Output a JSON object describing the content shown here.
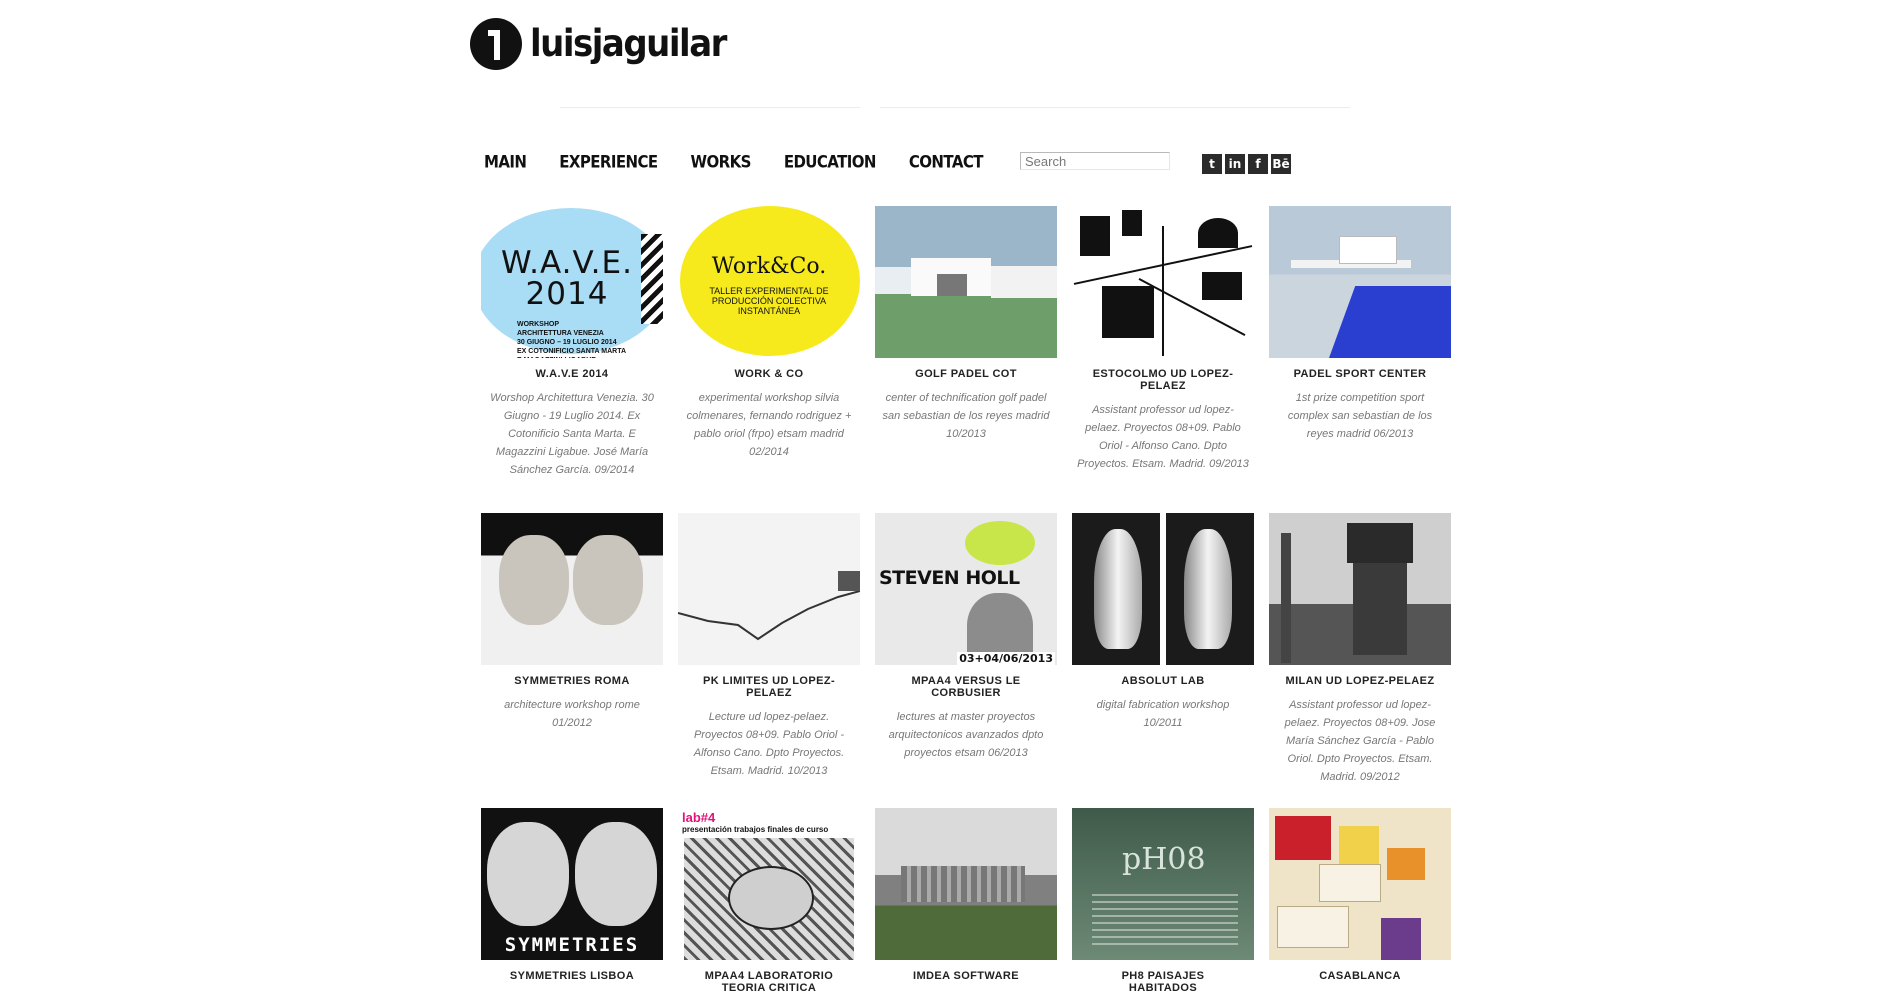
{
  "brand": {
    "name": "luisjaguilar"
  },
  "nav": {
    "items": [
      "MAIN",
      "EXPERIENCE",
      "WORKS",
      "EDUCATION",
      "CONTACT"
    ]
  },
  "search": {
    "placeholder": "Search"
  },
  "social": {
    "icons": [
      "twitter-icon",
      "linkedin-icon",
      "facebook-icon",
      "behance-icon"
    ],
    "labels": [
      "t",
      "in",
      "f",
      "Bē"
    ]
  },
  "works": [
    {
      "title": "W.A.V.E 2014",
      "desc": "Worshop Architettura Venezia. 30 Giugno - 19 Luglio 2014. Ex Cotonificio Santa Marta. E Magazzini Ligabue. José María Sánchez García. 09/2014"
    },
    {
      "title": "WORK & CO",
      "desc": "experimental workshop silvia colmenares, fernando rodriguez + pablo oriol (frpo) etsam madrid 02/2014"
    },
    {
      "title": "GOLF PADEL COT",
      "desc": "center of technification golf padel san sebastian de los reyes madrid 10/2013"
    },
    {
      "title": "ESTOCOLMO UD LOPEZ-PELAEZ",
      "desc": "Assistant professor ud lopez-pelaez. Proyectos 08+09. Pablo Oriol - Alfonso Cano. Dpto Proyectos. Etsam. Madrid. 09/2013"
    },
    {
      "title": "PADEL SPORT CENTER",
      "desc": "1st prize competition sport complex san sebastian de los reyes madrid 06/2013"
    },
    {
      "title": "SYMMETRIES ROMA",
      "desc": "architecture workshop rome 01/2012"
    },
    {
      "title": "PK LIMITES UD LOPEZ-PELAEZ",
      "desc": "Lecture ud lopez-pelaez. Proyectos 08+09. Pablo Oriol - Alfonso Cano. Dpto Proyectos. Etsam. Madrid. 10/2013"
    },
    {
      "title": "MPAA4 VERSUS LE CORBUSIER",
      "desc": "lectures at master proyectos arquitectonicos avanzados dpto proyectos etsam 06/2013"
    },
    {
      "title": "ABSOLUT LAB",
      "desc": "digital fabrication workshop 10/2011"
    },
    {
      "title": "MILAN UD LOPEZ-PELAEZ",
      "desc": "Assistant professor ud lopez-pelaez. Proyectos 08+09. Jose María Sánchez García - Pablo Oriol. Dpto Proyectos. Etsam. Madrid. 09/2012"
    },
    {
      "title": "SYMMETRIES LISBOA",
      "desc": ""
    },
    {
      "title": "MPAA4 LABORATORIO TEORIA CRITICA",
      "desc": ""
    },
    {
      "title": "IMDEA SOFTWARE",
      "desc": ""
    },
    {
      "title": "PH8 PAISAJES HABITADOS",
      "desc": ""
    },
    {
      "title": "CASABLANCA",
      "desc": ""
    }
  ],
  "thumb_text": {
    "wave_big": "W.A.V.E.\n2014",
    "wave_small": "WORKSHOP\nARCHITETTURA VENEZIA\n30 GIUGNO – 19 LUGLIO 2014\nEX COTONIFICIO SANTA MARTA\nE MAGAZZINI LIGABUE",
    "work_big": "Work&Co.",
    "work_small": "TALLER EXPERIMENTAL DE PRODUCCIÓN COLECTIVA INSTANTÁNEA",
    "mpaa_big": "STEVEN HOLL",
    "mpaa_date": "03+04/06/2013",
    "symlis_cap": "SYMMETRIES",
    "lab_title": "lab#4",
    "lab_sub": "presentación trabajos finales de curso",
    "ph8_big": "pH08"
  },
  "colors": {
    "wave_blue": "#a9dcf5",
    "workco_yellow": "#f6ea1d",
    "lab_pink": "#e2127a",
    "padel_blue": "#2a3fd0"
  }
}
